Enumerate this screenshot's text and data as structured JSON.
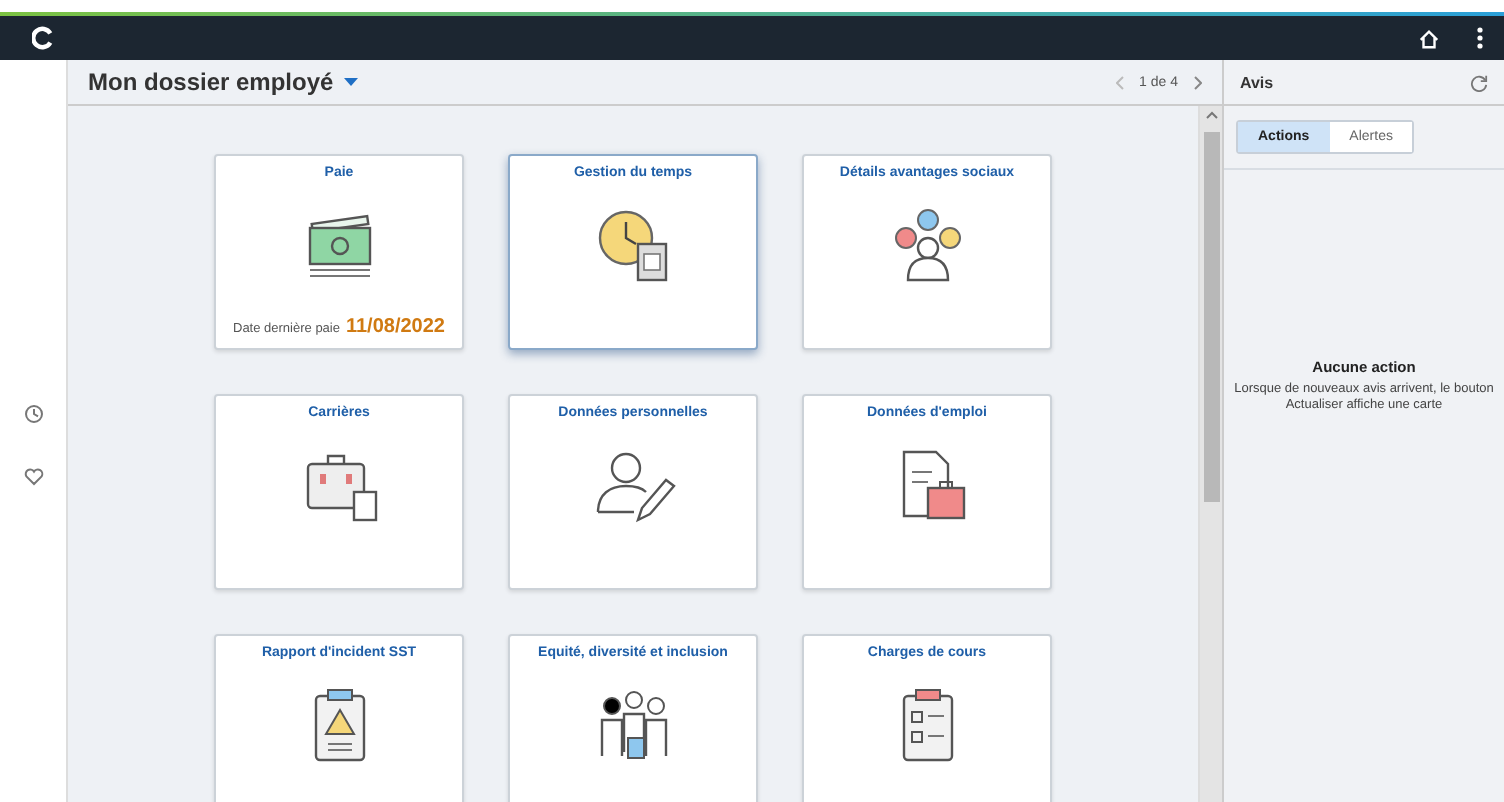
{
  "header": {
    "title": "Mon dossier employé",
    "pager": "1 de 4"
  },
  "tiles": [
    {
      "title": "Paie",
      "selected": false,
      "detail_label": "Date dernière paie",
      "detail_value": "11/08/2022"
    },
    {
      "title": "Gestion du temps",
      "selected": true
    },
    {
      "title": "Détails avantages sociaux",
      "selected": false
    },
    {
      "title": "Carrières",
      "selected": false
    },
    {
      "title": "Données personnelles",
      "selected": false
    },
    {
      "title": "Données d'emploi",
      "selected": false
    },
    {
      "title": "Rapport d'incident SST",
      "selected": false
    },
    {
      "title": "Equité, diversité et inclusion",
      "selected": false
    },
    {
      "title": "Charges de cours",
      "selected": false
    }
  ],
  "notices": {
    "title": "Avis",
    "tabs": [
      {
        "label": "Actions",
        "selected": true
      },
      {
        "label": "Alertes",
        "selected": false
      }
    ],
    "empty_title": "Aucune action",
    "empty_text": "Lorsque de nouveaux avis arrivent, le bouton Actualiser affiche une carte"
  }
}
